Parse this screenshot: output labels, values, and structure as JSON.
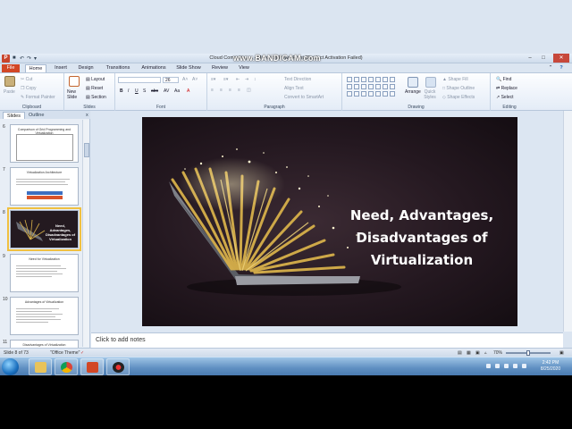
{
  "window": {
    "title": "Cloud Computing ... - Microsoft PowerPoint (Product Activation Failed)",
    "watermark": "www.BANDICAM.com"
  },
  "tabs": [
    "File",
    "Home",
    "Insert",
    "Design",
    "Transitions",
    "Animations",
    "Slide Show",
    "Review",
    "View"
  ],
  "ribbon": {
    "clipboard": {
      "label": "Clipboard",
      "paste": "Paste",
      "cut": "Cut",
      "copy": "Copy",
      "format_painter": "Format Painter"
    },
    "slides": {
      "label": "Slides",
      "new_slide": "New Slide",
      "layout": "Layout",
      "reset": "Reset",
      "section": "Section"
    },
    "font": {
      "label": "Font",
      "size": "26"
    },
    "paragraph": {
      "label": "Paragraph",
      "text_direction": "Text Direction",
      "align_text": "Align Text",
      "convert_smartart": "Convert to SmartArt"
    },
    "drawing": {
      "label": "Drawing",
      "arrange": "Arrange",
      "quick_styles": "Quick Styles",
      "shape_fill": "Shape Fill",
      "shape_outline": "Shape Outline",
      "shape_effects": "Shape Effects"
    },
    "editing": {
      "label": "Editing",
      "find": "Find",
      "replace": "Replace",
      "select": "Select"
    }
  },
  "pane": {
    "tab_slides": "Slides",
    "tab_outline": "Outline",
    "close": "x",
    "thumbs": [
      {
        "num": "6",
        "title": "Comparison of Grid Programming and Virtualization"
      },
      {
        "num": "7",
        "title": "Virtualization Architecture"
      },
      {
        "num": "8",
        "title": "Need, Advantages, Disadvantages of Virtualization"
      },
      {
        "num": "9",
        "title": "Need for Virtualization"
      },
      {
        "num": "10",
        "title": "Advantages of Virtualization"
      },
      {
        "num": "11",
        "title": "Disadvantages of Virtualization"
      }
    ]
  },
  "slide": {
    "title_lines": [
      "Need, Advantages,",
      "Disadvantages of",
      "Virtualization"
    ]
  },
  "notes_placeholder": "Click to add notes",
  "status": {
    "slide_counter": "Slide 8 of 73",
    "theme": "\"Office Theme\"",
    "zoom": "70%"
  },
  "taskbar": {
    "time": "2:42 PM",
    "date": "8/25/2020"
  }
}
